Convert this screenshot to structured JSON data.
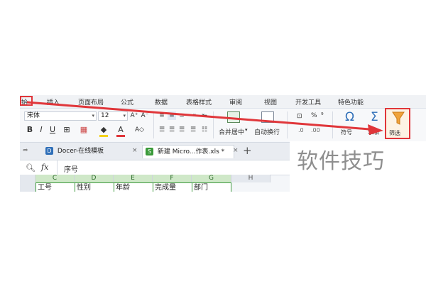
{
  "menu": {
    "start_partial": "始",
    "tabs": [
      "插入",
      "页面布局",
      "公式",
      "数据",
      "表格样式",
      "审阅",
      "视图",
      "开发工具",
      "特色功能"
    ]
  },
  "ribbon": {
    "font_name": "宋体",
    "font_size": "12",
    "merge_center": "合并居中",
    "wrap_text": "自动换行",
    "percent": "%",
    "symbol_partial": "符号",
    "sum_partial": "求和",
    "filter_partial": "筛选"
  },
  "doc_tabs": {
    "tab1": "Docer-在线模板",
    "tab2": "新建 Micro...作表.xls *",
    "tab1_badge": "D",
    "tab2_badge": "S"
  },
  "formula_bar": {
    "fx": "fx",
    "content": "序号"
  },
  "columns": [
    "C",
    "D",
    "E",
    "F",
    "G",
    "H"
  ],
  "row_cells": [
    "工号",
    "性别",
    "年龄",
    "完成量",
    "部门"
  ],
  "watermark": "软件技巧",
  "colors": {
    "highlight_red": "#e0363a",
    "selection_green": "#3f9a3f"
  }
}
